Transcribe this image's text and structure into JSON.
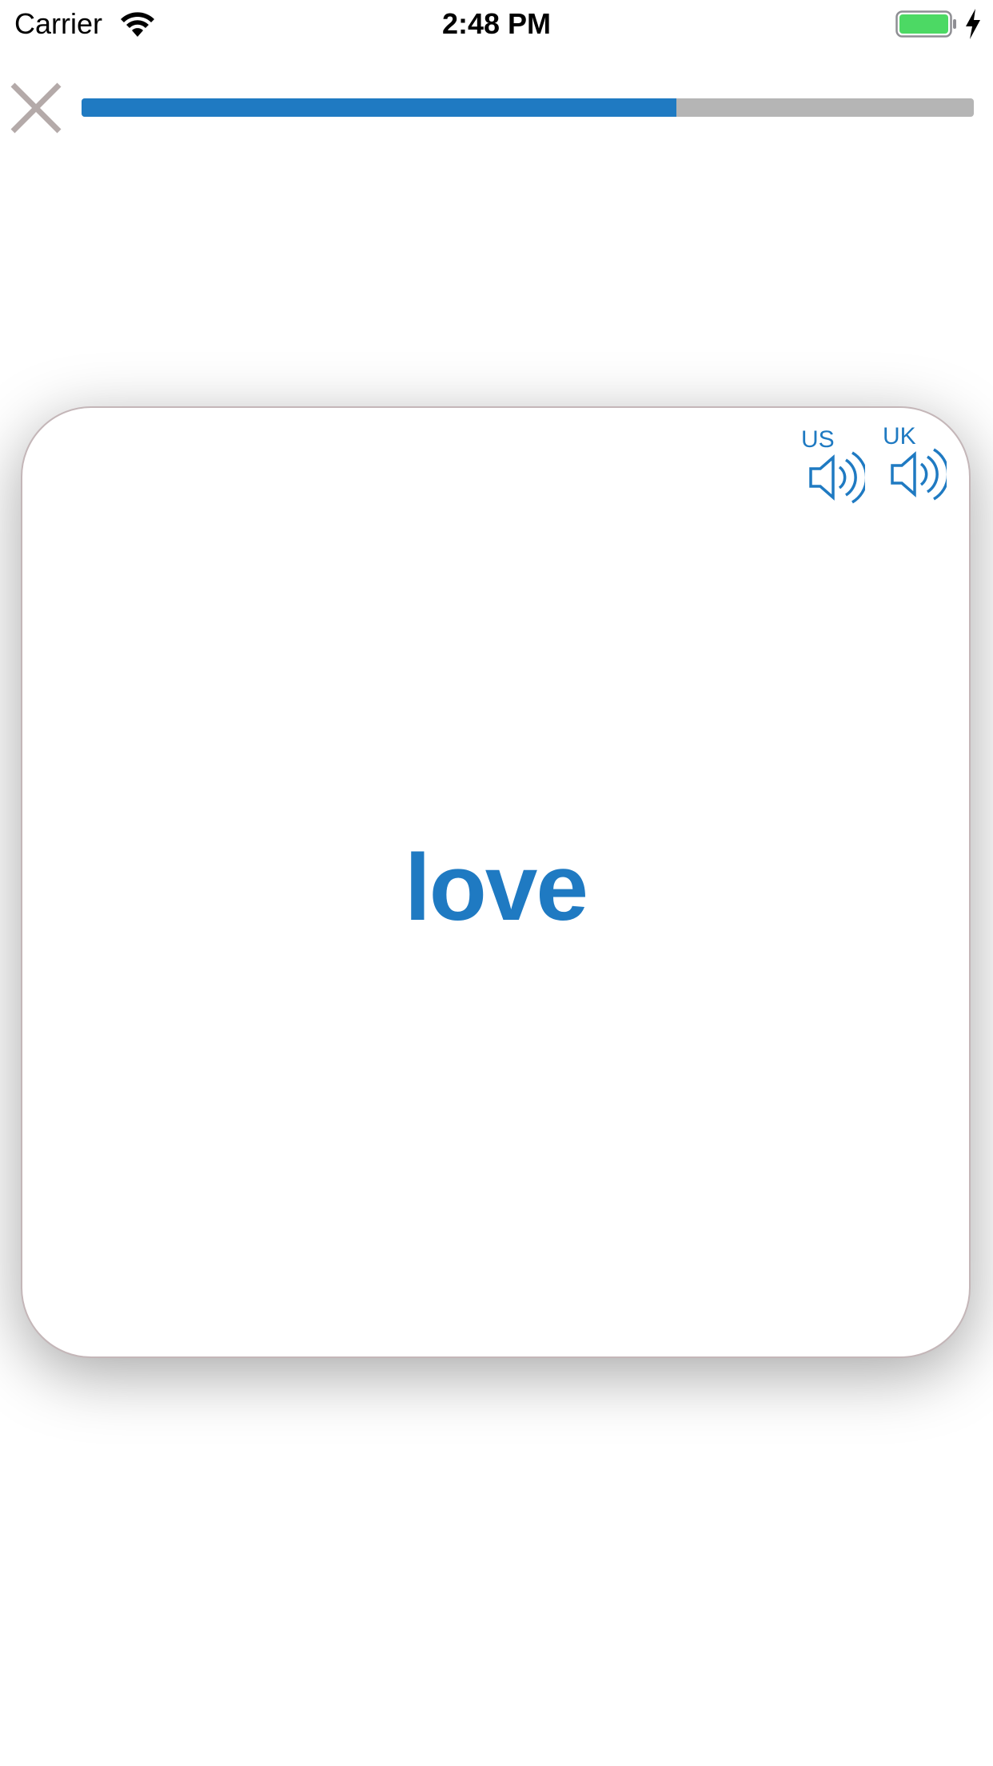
{
  "status_bar": {
    "carrier": "Carrier",
    "time": "2:48 PM",
    "battery_color": "#4cd964"
  },
  "top_bar": {
    "close_icon": "close-icon",
    "progress": 0.667,
    "progress_color": "#1f7ac2",
    "track_color": "#b5b5b5"
  },
  "card": {
    "word": "love",
    "pronunciations": [
      {
        "label": "US",
        "icon": "speaker-icon"
      },
      {
        "label": "UK",
        "icon": "speaker-icon"
      }
    ],
    "accent_color": "#1f7ac2"
  }
}
